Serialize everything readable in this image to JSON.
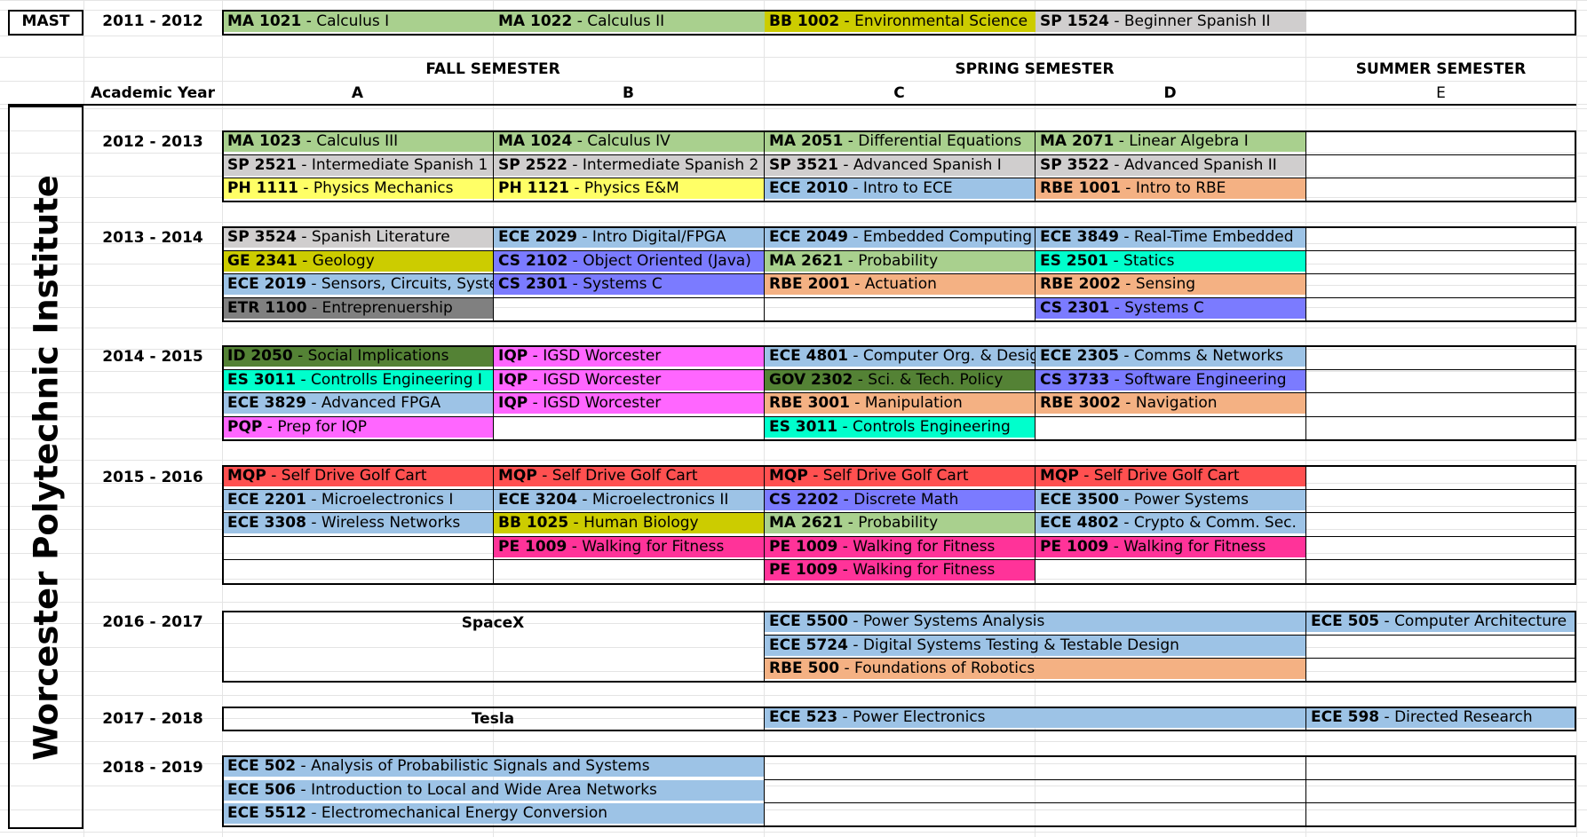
{
  "header": {
    "mast": "MAST",
    "mast_year": "2011 - 2012",
    "fall": "FALL SEMESTER",
    "spring": "SPRING SEMESTER",
    "summer": "SUMMER SEMESTER",
    "academic_year": "Academic Year",
    "col_a": "A",
    "col_b": "B",
    "col_c": "C",
    "col_d": "D",
    "col_e": "E"
  },
  "institute": "Worcester Polytechnic Institute",
  "colors": {
    "green": "#a9d08e",
    "grey": "#d0cece",
    "olive": "#cccc00",
    "yellow": "#ffff66",
    "blue": "#9dc3e6",
    "purple": "#7b7bff",
    "orange": "#f4b183",
    "teal": "#00ffcc",
    "darkgrey": "#808080",
    "darkgreen": "#548235",
    "pink": "#ff66ff",
    "red": "#ff5050",
    "magenta": "#ff3399"
  },
  "mast_row": [
    {
      "code": "MA 1021",
      "title": "Calculus I"
    },
    {
      "code": "MA 1022",
      "title": "Calculus II"
    },
    {
      "code": "BB 1002",
      "title": "Environmental Science"
    },
    {
      "code": "SP 1524",
      "title": "Beginner Spanish II"
    }
  ],
  "years": [
    "2012 - 2013",
    "2013 - 2014",
    "2014 - 2015",
    "2015 - 2016",
    "2016 - 2017",
    "2017 - 2018",
    "2018 - 2019"
  ],
  "courses": {
    "y1": [
      {
        "code": "MA 1023",
        "title": "Calculus III"
      },
      {
        "code": "MA 1024",
        "title": "Calculus IV"
      },
      {
        "code": "MA 2051",
        "title": "Differential Equations"
      },
      {
        "code": "MA 2071",
        "title": "Linear Algebra I"
      },
      {
        "code": "SP 2521",
        "title": "Intermediate Spanish 1"
      },
      {
        "code": "SP 2522",
        "title": "Intermediate Spanish 2"
      },
      {
        "code": "SP 3521",
        "title": "Advanced Spanish I"
      },
      {
        "code": "SP 3522",
        "title": "Advanced Spanish II"
      },
      {
        "code": "PH 1111",
        "title": "Physics Mechanics"
      },
      {
        "code": "PH 1121",
        "title": "Physics E&M"
      },
      {
        "code": "ECE 2010",
        "title": "Intro to ECE"
      },
      {
        "code": "RBE 1001",
        "title": "Intro to RBE"
      }
    ],
    "y2": [
      {
        "code": "SP 3524",
        "title": "Spanish Literature"
      },
      {
        "code": "ECE 2029",
        "title": "Intro Digital/FPGA"
      },
      {
        "code": "ECE 2049",
        "title": "Embedded Computing"
      },
      {
        "code": "ECE 3849",
        "title": "Real-Time Embedded"
      },
      {
        "code": "GE 2341",
        "title": "Geology"
      },
      {
        "code": "CS 2102",
        "title": "Object Oriented (Java)"
      },
      {
        "code": "MA 2621",
        "title": "Probability"
      },
      {
        "code": "ES 2501",
        "title": "Statics"
      },
      {
        "code": "ECE 2019",
        "title": "Sensors, Circuits, Systems"
      },
      {
        "code": "CS 2301",
        "title": "Systems C"
      },
      {
        "code": "RBE 2001",
        "title": "Actuation"
      },
      {
        "code": "RBE 2002",
        "title": "Sensing"
      },
      {
        "code": "ETR 1100",
        "title": "Entreprenuership"
      },
      {
        "code": "CS 2301",
        "title": "Systems C"
      }
    ],
    "y3": [
      {
        "code": "ID 2050",
        "title": "Social Implications"
      },
      {
        "code": "IQP",
        "title": "IGSD Worcester"
      },
      {
        "code": "ECE 4801",
        "title": "Computer Org. & Design"
      },
      {
        "code": "ECE 2305",
        "title": "Comms & Networks"
      },
      {
        "code": "ES 3011",
        "title": "Controlls Engineering I"
      },
      {
        "code": "IQP",
        "title": "IGSD Worcester"
      },
      {
        "code": "GOV 2302",
        "title": "Sci. & Tech. Policy"
      },
      {
        "code": "CS 3733",
        "title": "Software Engineering"
      },
      {
        "code": "ECE 3829",
        "title": "Advanced FPGA"
      },
      {
        "code": "IQP",
        "title": "IGSD Worcester"
      },
      {
        "code": "RBE 3001",
        "title": "Manipulation"
      },
      {
        "code": "RBE 3002",
        "title": "Navigation"
      },
      {
        "code": "PQP",
        "title": "Prep for IQP"
      },
      {
        "code": "ES 3011",
        "title": "Controls Engineering"
      }
    ],
    "y4": [
      {
        "code": "MQP",
        "title": "Self Drive Golf Cart"
      },
      {
        "code": "MQP",
        "title": "Self Drive Golf Cart"
      },
      {
        "code": "MQP",
        "title": "Self Drive Golf Cart"
      },
      {
        "code": "MQP",
        "title": "Self Drive Golf Cart"
      },
      {
        "code": "ECE 2201",
        "title": "Microelectronics I"
      },
      {
        "code": "ECE 3204",
        "title": "Microelectronics II"
      },
      {
        "code": "CS 2202",
        "title": "Discrete Math"
      },
      {
        "code": "ECE 3500",
        "title": "Power Systems"
      },
      {
        "code": "ECE 3308",
        "title": "Wireless Networks"
      },
      {
        "code": "BB 1025",
        "title": "Human Biology"
      },
      {
        "code": "MA 2621",
        "title": "Probability"
      },
      {
        "code": "ECE 4802",
        "title": "Crypto & Comm. Sec."
      },
      {
        "code": "PE 1009",
        "title": "Walking for Fitness"
      },
      {
        "code": "PE 1009",
        "title": "Walking for Fitness"
      },
      {
        "code": "PE 1009",
        "title": "Walking for Fitness"
      },
      {
        "code": "PE 1009",
        "title": "Walking for Fitness"
      }
    ],
    "y5": {
      "fall": "SpaceX",
      "spring": [
        {
          "code": "ECE 5500",
          "title": "Power Systems Analysis"
        },
        {
          "code": "ECE 5724",
          "title": "Digital Systems Testing & Testable Design"
        },
        {
          "code": "RBE 500",
          "title": "Foundations of Robotics"
        }
      ],
      "summer": {
        "code": "ECE 505",
        "title": "Computer Architecture"
      }
    },
    "y6": {
      "fall": "Tesla",
      "spring": {
        "code": "ECE 523",
        "title": "Power Electronics"
      },
      "summer": {
        "code": "ECE 598",
        "title": "Directed Research"
      }
    },
    "y7": [
      {
        "code": "ECE 502",
        "title": "Analysis of Probabilistic Signals and Systems"
      },
      {
        "code": "ECE 506",
        "title": "Introduction to Local and Wide Area Networks"
      },
      {
        "code": "ECE 5512",
        "title": "Electromechanical Energy Conversion"
      }
    ]
  }
}
